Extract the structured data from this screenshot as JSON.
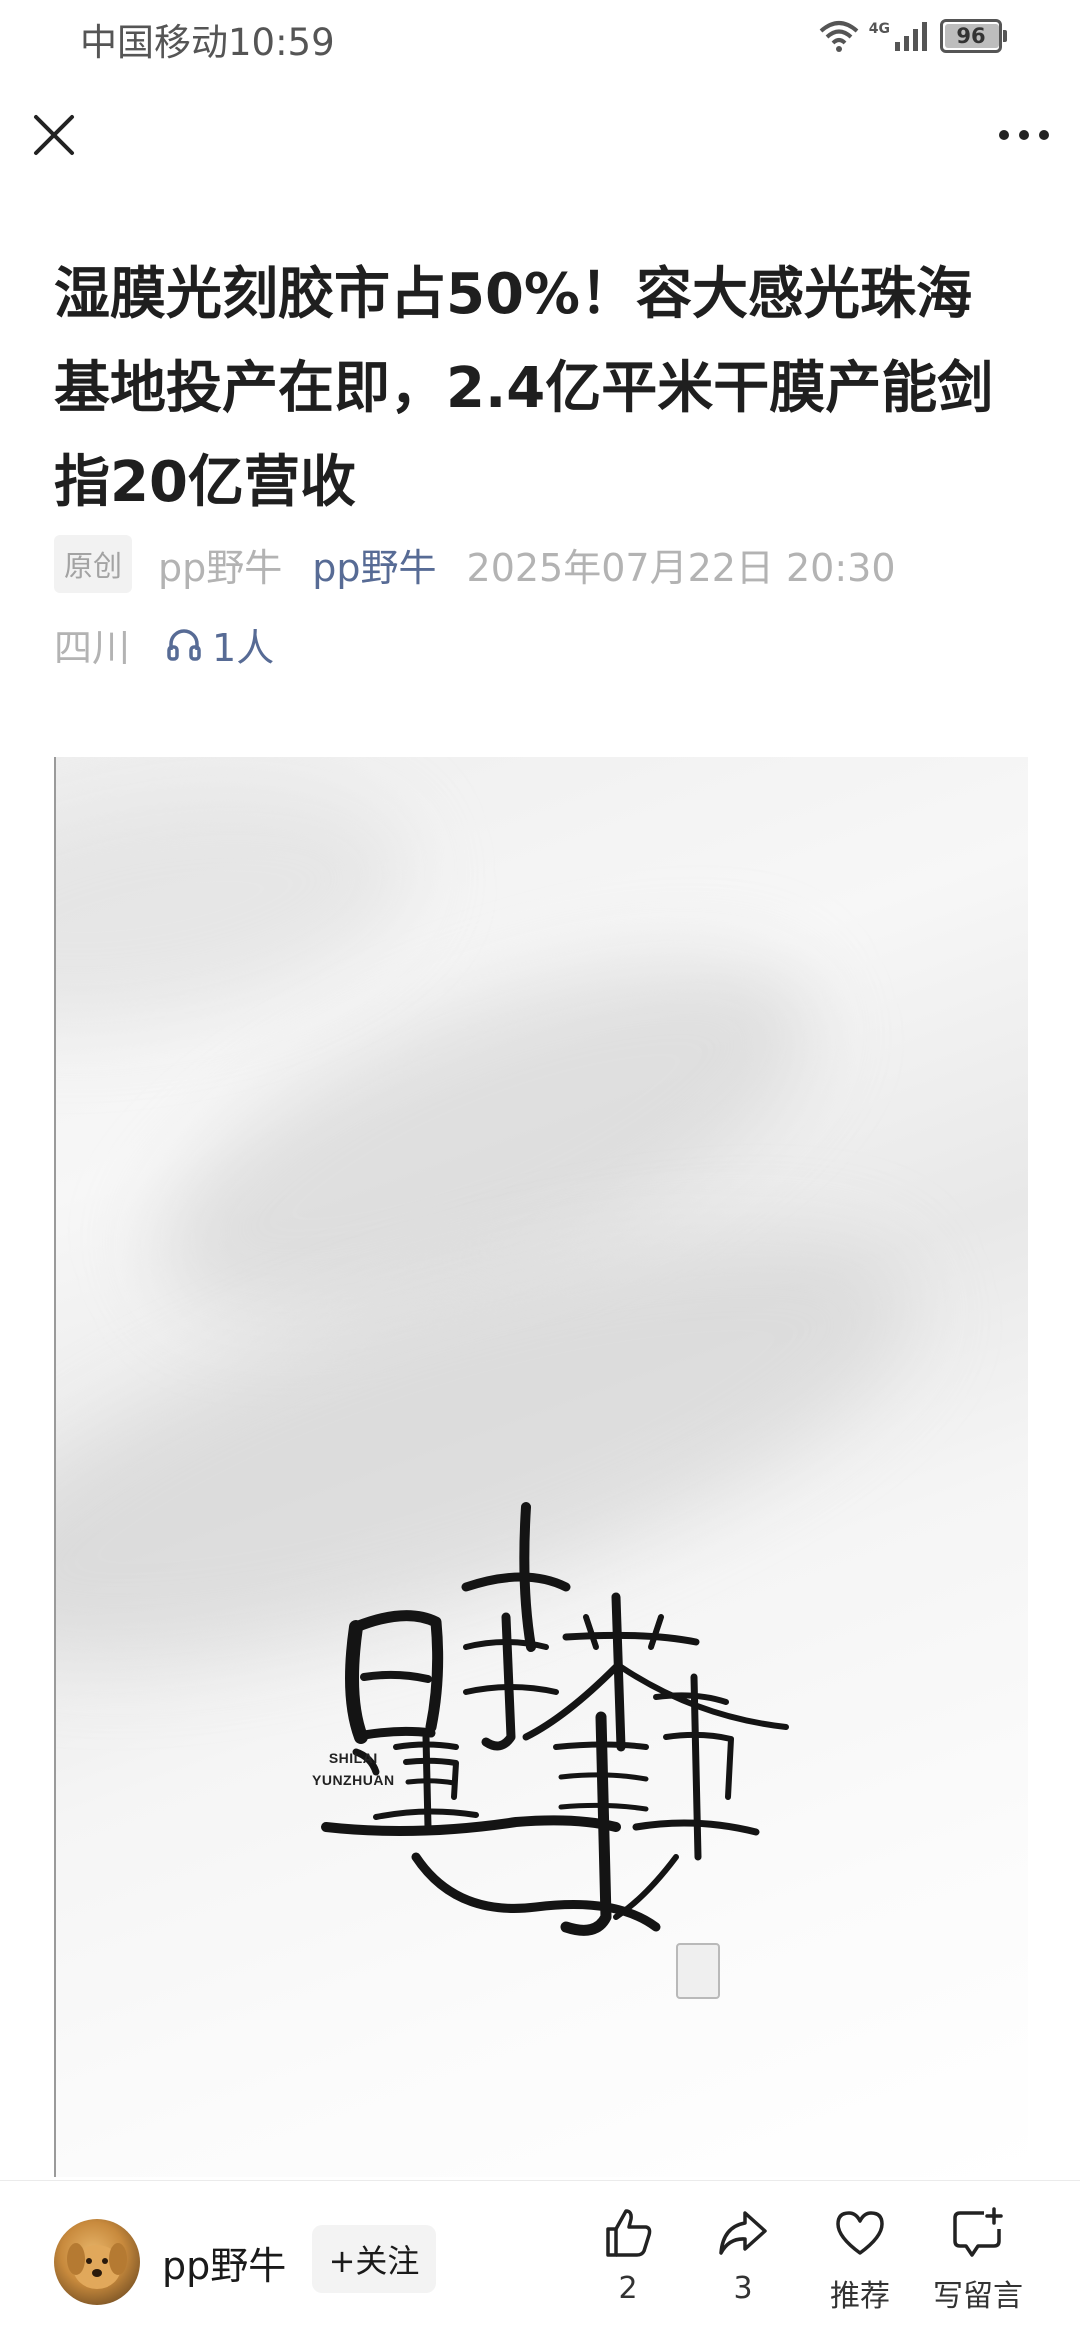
{
  "status_bar": {
    "carrier": "中国移动",
    "time": "10:59",
    "network": "4G",
    "battery": "96",
    "battery_level": 0.96
  },
  "nav": {
    "close_icon": "close-icon",
    "more_icon": "more-dots-icon"
  },
  "article": {
    "title": "湿膜光刻胶市占50%！容大感光珠海基地投产在即，2.4亿平米干膜产能剑指20亿营收",
    "original_tag": "原创",
    "author_plain": "pp野牛",
    "account_link": "pp野牛",
    "date": "2025年07月22日 20:30",
    "location": "四川",
    "listen_count": "1人"
  },
  "image": {
    "calligraphy_en": "SHILAI\nYUNZHUAN"
  },
  "bottom_bar": {
    "author_name": "pp野牛",
    "follow_label": "+关注",
    "like_count": "2",
    "share_count": "3",
    "recommend_label": "推荐",
    "comment_label": "写留言"
  }
}
